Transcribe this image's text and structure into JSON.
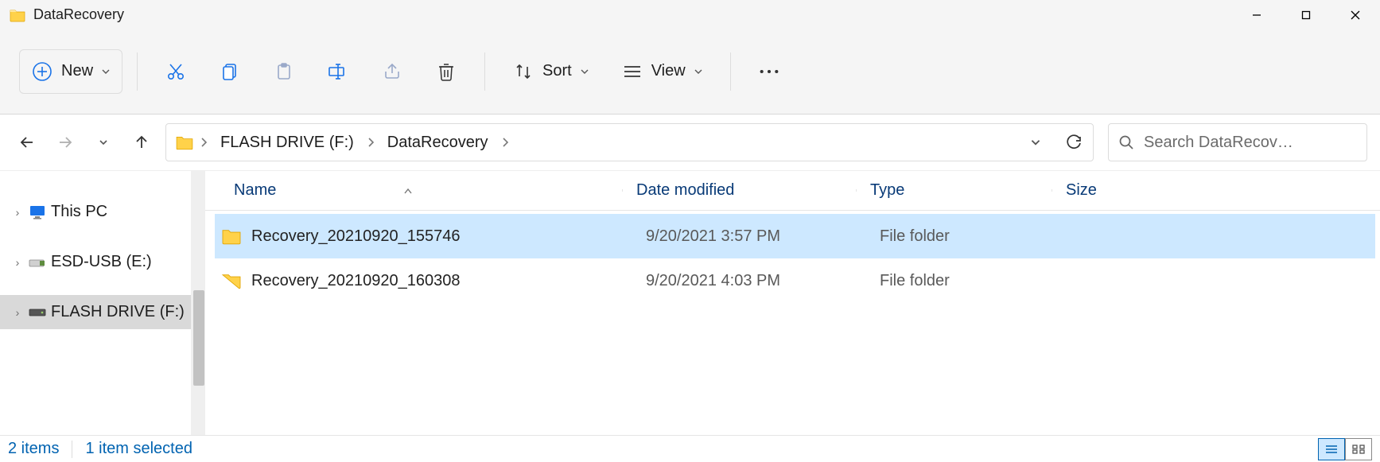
{
  "window": {
    "title": "DataRecovery"
  },
  "toolbar": {
    "new_label": "New",
    "sort_label": "Sort",
    "view_label": "View"
  },
  "breadcrumb": {
    "items": [
      "FLASH DRIVE (F:)",
      "DataRecovery"
    ]
  },
  "search": {
    "placeholder": "Search DataRecov…"
  },
  "sidebar": {
    "items": [
      {
        "label": "This PC",
        "icon": "monitor-icon",
        "selected": false
      },
      {
        "label": "ESD-USB (E:)",
        "icon": "usb-icon",
        "selected": false
      },
      {
        "label": "FLASH DRIVE (F:)",
        "icon": "drive-icon",
        "selected": true
      }
    ]
  },
  "columns": {
    "name": "Name",
    "date": "Date modified",
    "type": "Type",
    "size": "Size"
  },
  "rows": [
    {
      "name": "Recovery_20210920_155746",
      "date": "9/20/2021 3:57 PM",
      "type": "File folder",
      "size": "",
      "selected": true
    },
    {
      "name": "Recovery_20210920_160308",
      "date": "9/20/2021 4:03 PM",
      "type": "File folder",
      "size": "",
      "selected": false
    }
  ],
  "status": {
    "count": "2 items",
    "selection": "1 item selected"
  }
}
